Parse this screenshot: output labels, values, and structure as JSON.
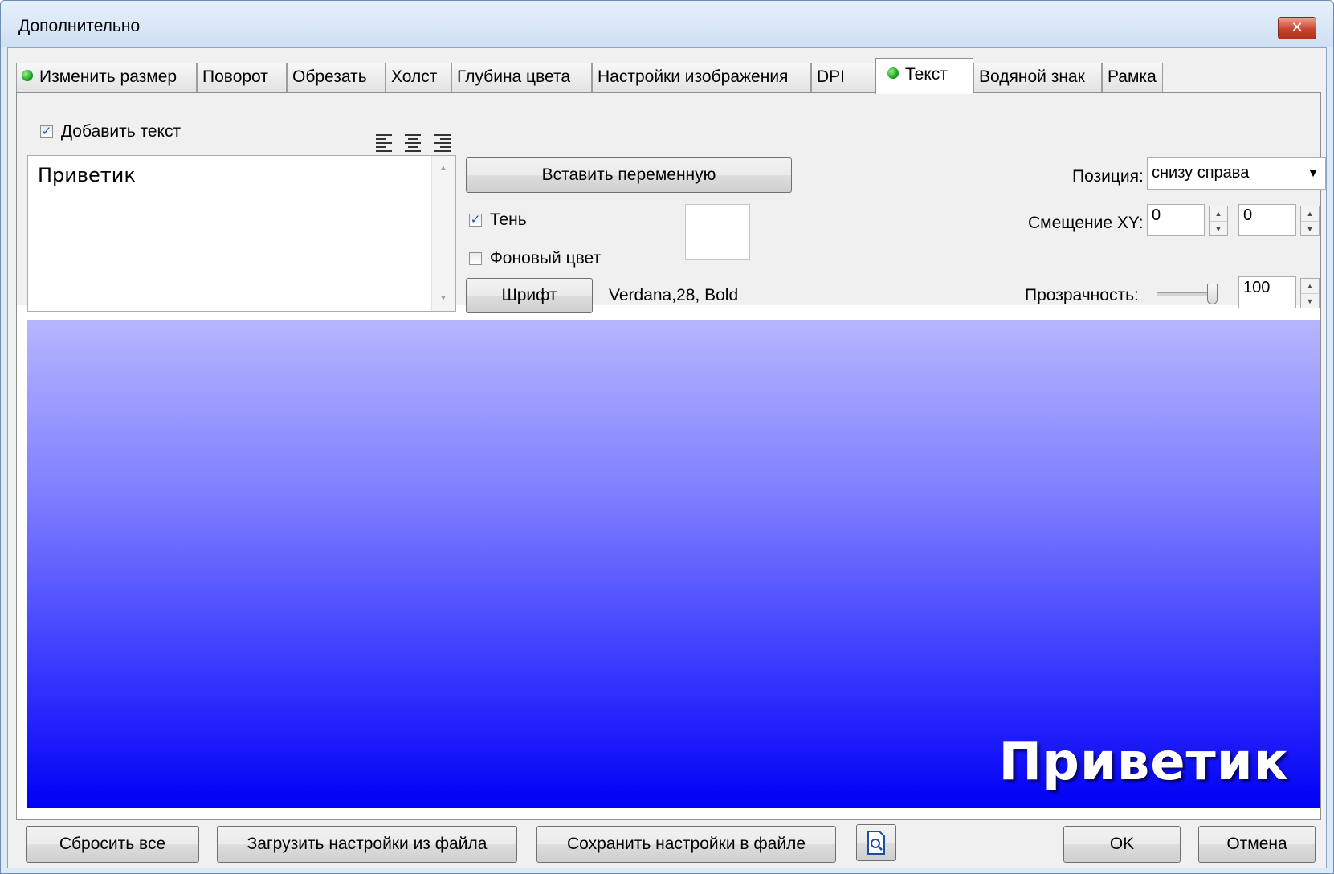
{
  "window": {
    "title": "Дополнительно",
    "close_symbol": "✕"
  },
  "tabs": [
    {
      "label": "Изменить размер",
      "indicator": "green-dot"
    },
    {
      "label": "Поворот"
    },
    {
      "label": "Обрезать"
    },
    {
      "label": "Холст"
    },
    {
      "label": "Глубина цвета"
    },
    {
      "label": "Настройки изображения"
    },
    {
      "label": "DPI"
    },
    {
      "label": "Текст",
      "indicator": "green-dot",
      "active": true
    },
    {
      "label": "Водяной знак"
    },
    {
      "label": "Рамка"
    }
  ],
  "text_panel": {
    "add_text_label": "Добавить текст",
    "add_text_checked": true,
    "text_value": "Приветик",
    "insert_variable_label": "Вставить переменную",
    "shadow_label": "Тень",
    "shadow_checked": true,
    "bg_color_label": "Фоновый цвет",
    "bg_color_checked": false,
    "font_button_label": "Шрифт",
    "font_value": "Verdana,28, Bold",
    "position_label": "Позиция:",
    "position_value": "снизу справа",
    "offset_label": "Смещение XY:",
    "offset_x": "0",
    "offset_y": "0",
    "opacity_label": "Прозрачность:",
    "opacity_value": "100"
  },
  "preview": {
    "text": "Приветик",
    "gradient_top": "#b6b6ff",
    "gradient_bottom": "#0000f5"
  },
  "footer": {
    "reset_all": "Сбросить все",
    "load_settings": "Загрузить настройки из файла",
    "save_settings": "Сохранить настройки в файле",
    "ok": "OK",
    "cancel": "Отмена"
  }
}
